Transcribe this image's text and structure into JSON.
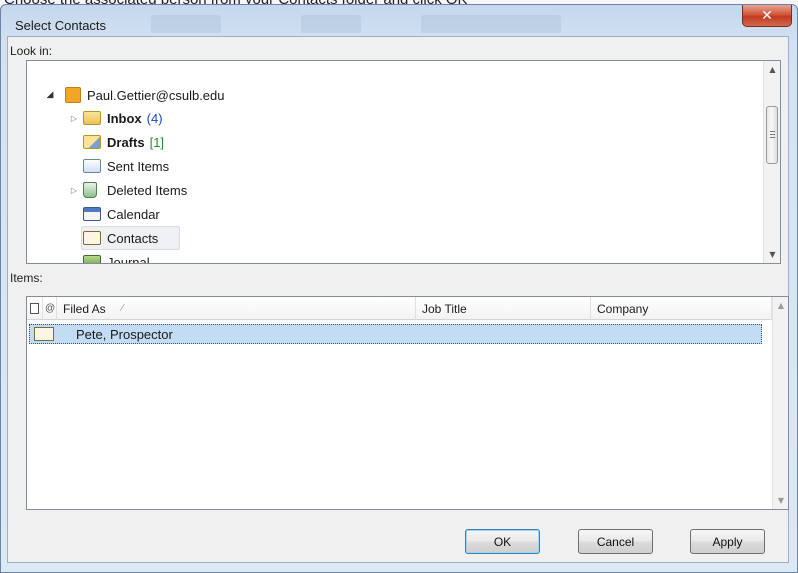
{
  "background_text": "Choose the associated person from your Contacts folder and click OK",
  "window": {
    "title": "Select Contacts",
    "close_glyph": "✕"
  },
  "look_in": {
    "label": "Look in:",
    "tree": [
      {
        "label": "Paul.Gettier@csulb.edu",
        "icon": "mailbox-icon"
      },
      {
        "label": "Inbox",
        "count": "(4)",
        "icon": "inbox-folder-icon"
      },
      {
        "label": "Drafts",
        "count": "[1]",
        "icon": "drafts-folder-icon"
      },
      {
        "label": "Sent Items",
        "icon": "sent-items-icon"
      },
      {
        "label": "Deleted Items",
        "icon": "deleted-items-icon"
      },
      {
        "label": "Calendar",
        "icon": "calendar-icon"
      },
      {
        "label": "Contacts",
        "icon": "contacts-icon"
      },
      {
        "label": "Journal",
        "icon": "journal-icon"
      }
    ]
  },
  "items": {
    "label": "Items:",
    "columns": {
      "filed_as": "Filed As",
      "job_title": "Job Title",
      "company": "Company"
    },
    "rows": [
      {
        "filed_as": "Pete, Prospector"
      }
    ]
  },
  "buttons": {
    "ok": "OK",
    "cancel": "Cancel",
    "apply": "Apply"
  },
  "colors": {
    "selection": "#c2dcf4",
    "inbox_count": "#1c46c8",
    "drafts_count": "#2c8a2c",
    "close_button": "#c23a1e"
  }
}
